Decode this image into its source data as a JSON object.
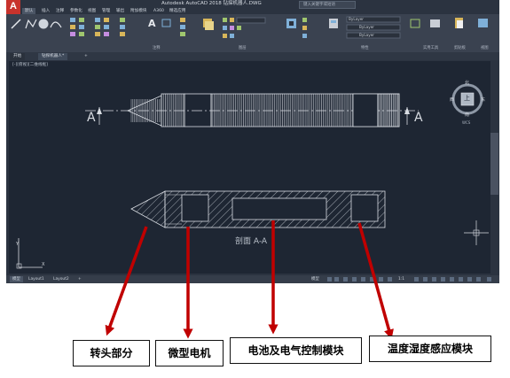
{
  "titlebar": {
    "logo": "A",
    "title": "Autodesk AutoCAD 2018   钻探机器人.DWG",
    "search_placeholder": "键入关键字或短语"
  },
  "ribbon_tabs": [
    "默认",
    "插入",
    "注释",
    "参数化",
    "视图",
    "管理",
    "输出",
    "附加模块",
    "A360",
    "精选应用"
  ],
  "ribbon_panels": {
    "annotate": "注释",
    "layers": "图层",
    "properties": "特性",
    "utilities": "实用工具",
    "clipboard": "剪贴板",
    "view": "视图"
  },
  "layer_dropdown": "ByLayer",
  "layer_dropdown2": "ByLayer",
  "layer_dropdown3": "ByLayer",
  "doc_tabs": [
    "开始",
    "钻探机器人*"
  ],
  "viewport_label": "[-][俯视][二维线框]",
  "viewcube": {
    "top": "上",
    "north": "北",
    "south": "南",
    "east": "东",
    "west": "西",
    "wcs": "WCS"
  },
  "drawing": {
    "section_mark": "A",
    "section_caption": "剖面  A-A"
  },
  "status": {
    "layout_tabs": [
      "模型",
      "Layout1",
      "Layout2"
    ],
    "model": "模型",
    "scale": "1:1"
  },
  "annotations": [
    {
      "label": "转头部分"
    },
    {
      "label": "微型电机"
    },
    {
      "label": "电池及电气控制模块"
    },
    {
      "label": "温度湿度感应模块"
    }
  ],
  "colors": {
    "arrow": "#c00000",
    "drawing": "#d9dde3",
    "background": "#1e2633"
  }
}
